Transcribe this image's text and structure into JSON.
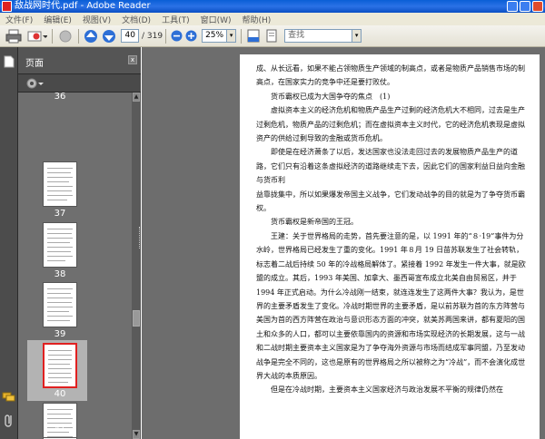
{
  "window": {
    "title": "敌战网时代.pdf - Adobe Reader"
  },
  "menu": [
    "文件(F)",
    "编辑(E)",
    "视图(V)",
    "文档(D)",
    "工具(T)",
    "窗口(W)",
    "帮助(H)"
  ],
  "toolbar": {
    "page_current": "40",
    "page_total": "/ 319",
    "zoom": "25%",
    "search_placeholder": "查找"
  },
  "panel": {
    "title": "页面",
    "close": "x"
  },
  "thumbnails": [
    "36",
    "37",
    "38",
    "39",
    "40",
    "41",
    "42"
  ],
  "selected_page": "40",
  "page_text": [
    "成、从长远看，如果不能占领物质生产领域的制高点，或者是物质产品销售市场的制高点，在国家实力的竞争中还是要打败仗。",
    "货币霸权已成为大国争夺的焦点　(1)",
    "虚拟资本主义的经济危机和物质产品生产过剩的经济危机大不相同，过去是生产过剩危机，物质产品的过剩危机；而在虚拟资本主义时代，它的经济危机表现是虚拟资产的供给过剩导致的金融或货币危机。",
    "即使是在经济萧条了以后，发达国家也没法走回过去的发展物质产品生产的道路，它们只有沿着这条虚拟经济的道路继续走下去，因此它们的国家利益日益向金融与货币利",
    "益靠拢集中，所以如果爆发帝国主义战争，它们发动战争的目的就是为了争夺货币霸权。",
    "货币霸权是新帝国的王冠。",
    "王建：关于世界格局的走势，首先要注意的是，以 1991 年的“８·19”事件为分水岭，世界格局已经发生了重的变化。1991 年８月 19 日苗苏联发生了社会转轨，标志着二战后持续 50 年的冷战格局解体了。紧接着 1992 年发生一件大事，就是欧盟的成立。其后，1993 年美国、加拿大、墨西哥宣布成立北美自由贸易区，并于 1994 年正式启动。为什么冷战刚一结束，就连连发生了这两件大事？我认为，是世界的主要矛盾发生了变化。冷战时期世界的主要矛盾，是以前苏联为首的东方阵营与美国为首的西方阵营在政治与意识形态方面的冲突，就美苏两国来讲，都有夏阳的国土和众多的人口，都可以主要依靠国内的资源和市场实现经济的长期发展，这与一战和二战时期主要资本主义国家是为了争夺海外资源与市场而结成军事同盟，乃至发动战争是完全不同的，这也是原有的世界格局之所以被称之为“冷战”，而不会演化成世界大战的本质原因。",
    "但是在冷战时期，主要资本主义国家经济与政治发展不平衡的规律仍然在"
  ],
  "colors": {
    "panel_bg": "#3a3a3a",
    "doc_bg": "#6d6d6d",
    "selection": "#e02020"
  },
  "icons": [
    "print-icon",
    "email-icon",
    "gray-icon",
    "up-arrow-icon",
    "down-arrow-icon",
    "zoom-out-icon",
    "zoom-in-icon",
    "save-icon",
    "fit-page-icon",
    "pages-icon",
    "comments-icon",
    "attachment-icon",
    "options-icon"
  ]
}
